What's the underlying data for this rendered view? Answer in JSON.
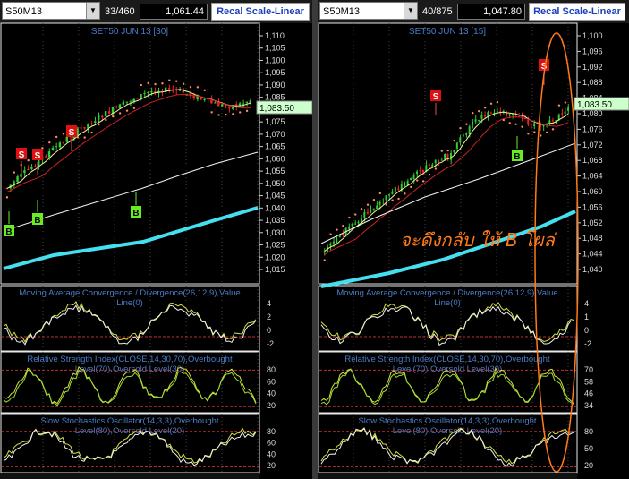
{
  "left": {
    "symbol": "S50M13",
    "bar_count": "33/460",
    "last_price": "1,061.44",
    "recal_button": "Recal Scale-Linear",
    "chart_title": "SET50 JUN 13   [30]",
    "price_tag": "1,083.50",
    "price_axis": [
      "1,110",
      "1,105",
      "1,100",
      "1,095",
      "1,090",
      "1,085",
      "1,080",
      "1,075",
      "1,070",
      "1,065",
      "1,060",
      "1,055",
      "1,050",
      "1,045",
      "1,040",
      "1,035",
      "1,030",
      "1,025",
      "1,020",
      "1,015"
    ],
    "macd_title": "Moving Average Convergence / Divergence(26,12,9),Value",
    "macd_sub": "Line(0)",
    "macd_axis": [
      "4",
      "2",
      "0",
      "-2"
    ],
    "rsi_title": "Relative Strength Index(CLOSE,14,30,70),Overbought",
    "rsi_sub": "Level(70),Oversold Level(30)",
    "rsi_axis": [
      "80",
      "60",
      "40",
      "20"
    ],
    "stoch_title": "Slow Stochastics Oscillator(14,3,3),Overbought",
    "stoch_sub": "Level(80),Oversold Level(20)",
    "stoch_axis": [
      "80",
      "60",
      "40",
      "20"
    ],
    "signals": [
      "S",
      "S",
      "S",
      "B",
      "B",
      "B"
    ]
  },
  "right": {
    "symbol": "S50M13",
    "bar_count": "40/875",
    "last_price": "1,047.80",
    "recal_button": "Recal Scale-Linear",
    "chart_title": "SET50 JUN 13   [15]",
    "price_tag": "1,083.50",
    "price_axis": [
      "1,100",
      "1,096",
      "1,092",
      "1,088",
      "1,084",
      "1,080",
      "1,076",
      "1,072",
      "1,068",
      "1,064",
      "1,060",
      "1,056",
      "1,052",
      "1,048",
      "1,044",
      "1,040"
    ],
    "macd_title": "Moving Average Convergence / Divergence(26,12,9),Value",
    "macd_sub": "Line(0)",
    "macd_axis": [
      "4",
      "1",
      "0",
      "-2"
    ],
    "rsi_title": "Relative Strength Index(CLOSE,14,30,70),Overbought",
    "rsi_sub": "Level(70),Oversold Level(30)",
    "rsi_axis": [
      "70",
      "58",
      "46",
      "34"
    ],
    "stoch_title": "Slow Stochastics Oscillator(14,3,3),Overbought",
    "stoch_sub": "Level(80),Oversold Level(20)",
    "stoch_axis": [
      "80",
      "50",
      "20"
    ],
    "signals": [
      "S",
      "S",
      "B"
    ],
    "annotation": "จะดึงกลับ ให้ B โผล่"
  },
  "colors": {
    "price_green": "#33cc33",
    "price_red": "#ee2222",
    "ma_cyan": "#44e0f0",
    "signal_sell": "#e01010",
    "signal_buy": "#66ee22",
    "tag_bg": "#ccffcc",
    "title_blue": "#4a7cc8",
    "annotation_orange": "#ff7a1a"
  },
  "icons": {
    "dropdown": "chevron-down-icon"
  }
}
